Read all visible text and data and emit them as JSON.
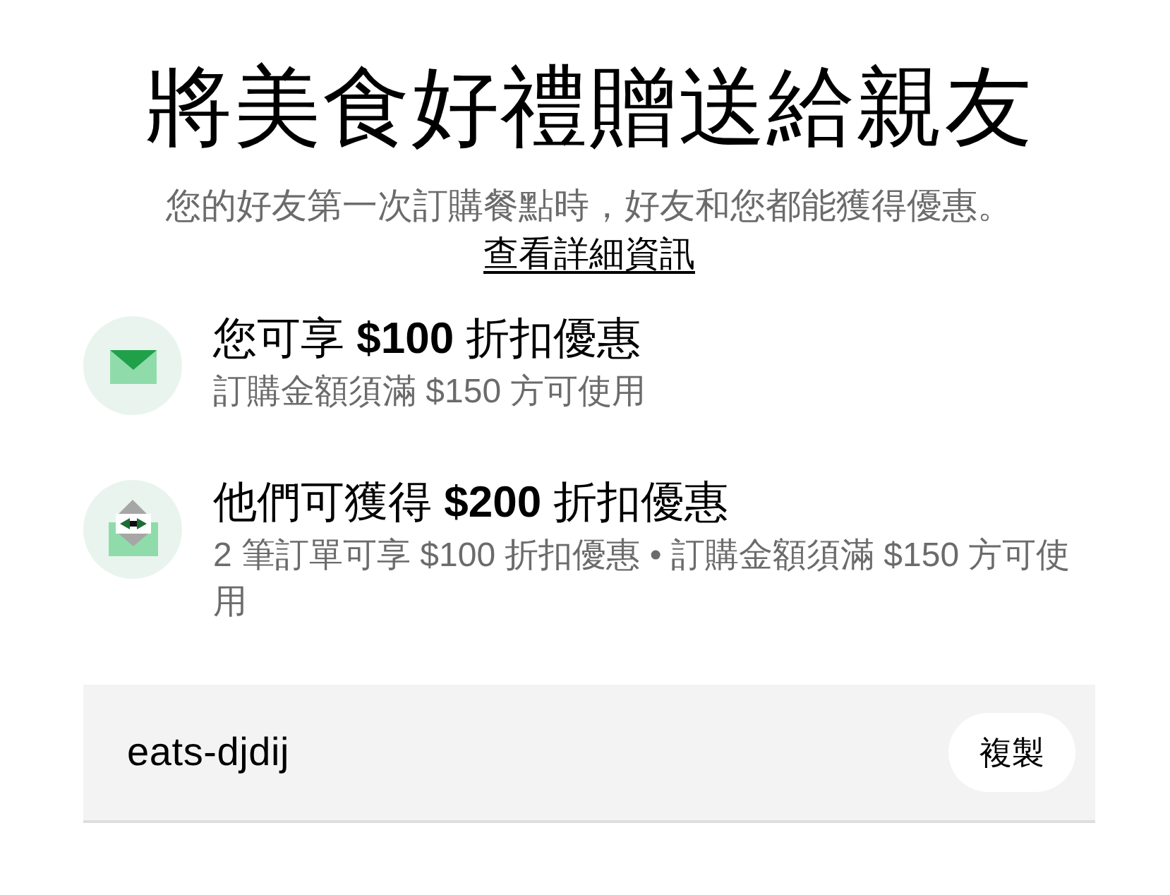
{
  "title": "將美食好禮贈送給親友",
  "subtitle": "您的好友第一次訂購餐點時，好友和您都能獲得優惠。",
  "details_link": "查看詳細資訊",
  "offers": [
    {
      "kind": "envelope",
      "title": "您可享 **$100** 折扣優惠",
      "description": "訂購金額須滿 $150 方可使用"
    },
    {
      "kind": "gift_envelope",
      "title": "他們可獲得 **$200** 折扣優惠",
      "description": "2 筆訂單可享 $100 折扣優惠 • 訂購金額須滿 $150 方可使用"
    }
  ],
  "invite_code": {
    "value": "eats-djdij",
    "copy_button": "複製"
  }
}
